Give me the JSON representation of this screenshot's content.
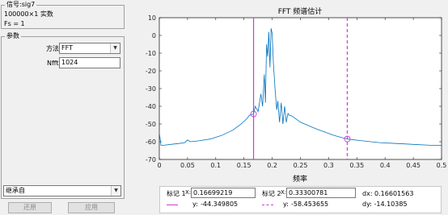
{
  "signal": {
    "group_label": "信号:sig7",
    "size_text": "100000×1 实数",
    "fs_text": "Fs = 1"
  },
  "params": {
    "group_label": "参数",
    "method_label": "方法",
    "method_value": "FFT",
    "nfft_label": "Nfft",
    "nfft_value": "1024"
  },
  "inherit": {
    "value": "继承自"
  },
  "buttons": {
    "revert": "还原",
    "apply": "应用"
  },
  "markers": {
    "m1_label": "标记 1",
    "m2_label": "标记 2",
    "x_tag": "X:",
    "y_tag": "y:",
    "m1_x": "0.16699219",
    "m1_y": "-44.349805",
    "m2_x": "0.33300781",
    "m2_y": "-58.453655",
    "dx_text": "dx: 0.16601563",
    "dy_text": "dy: -14.10385"
  },
  "colors": {
    "curve": "#0072bd",
    "marker": "#d03ad6"
  },
  "chart_data": {
    "type": "line",
    "title": "FFT 频谱估计",
    "xlabel": "频率",
    "ylabel": "",
    "xlim": [
      0,
      0.5
    ],
    "ylim": [
      -70,
      10
    ],
    "xticks": [
      0,
      0.05,
      0.1,
      0.15,
      0.2,
      0.25,
      0.3,
      0.35,
      0.4,
      0.45,
      0.5
    ],
    "xtick_labels": [
      "0",
      "0.05",
      "0.1",
      "0.15",
      "0.2",
      "0.25",
      "0.3",
      "0.35",
      "0.4",
      "0.45",
      "0.5"
    ],
    "yticks": [
      -70,
      -60,
      -50,
      -40,
      -30,
      -20,
      -10,
      0,
      10
    ],
    "ytick_labels": [
      "-70",
      "-60",
      "-50",
      "-40",
      "-30",
      "-20",
      "-10",
      "0",
      "10"
    ],
    "grid": false,
    "series": [
      {
        "x": [
          0,
          0.003,
          0.008,
          0.02,
          0.035,
          0.045,
          0.05,
          0.055,
          0.07,
          0.09,
          0.11,
          0.13,
          0.145,
          0.155,
          0.16,
          0.167,
          0.17,
          0.175,
          0.18,
          0.183,
          0.186,
          0.188,
          0.19,
          0.192,
          0.194,
          0.196,
          0.198,
          0.2,
          0.202,
          0.205,
          0.208,
          0.21,
          0.213,
          0.216,
          0.219,
          0.222,
          0.225,
          0.228,
          0.23,
          0.235,
          0.25,
          0.28,
          0.31,
          0.333,
          0.36,
          0.39,
          0.42,
          0.45,
          0.48,
          0.5
        ],
        "y": [
          -55,
          -62,
          -62,
          -61.5,
          -61,
          -60.5,
          -59,
          -60,
          -59.5,
          -58.5,
          -56.5,
          -53.5,
          -50,
          -47,
          -45,
          -44.3,
          -40,
          -43,
          -33,
          -40,
          -22,
          -38,
          -5,
          -12,
          2,
          -18,
          4,
          1,
          -15,
          -30,
          -42,
          -37,
          -49,
          -38,
          -50,
          -40,
          -49,
          -44,
          -45,
          -45.5,
          -49,
          -53,
          -56.5,
          -58.5,
          -59.5,
          -60.5,
          -61,
          -61.5,
          -62,
          -62
        ]
      }
    ],
    "markers": [
      {
        "x": 0.16699219,
        "y": -44.349805,
        "style": "solid"
      },
      {
        "x": 0.33300781,
        "y": -58.453655,
        "style": "dashed"
      }
    ]
  }
}
